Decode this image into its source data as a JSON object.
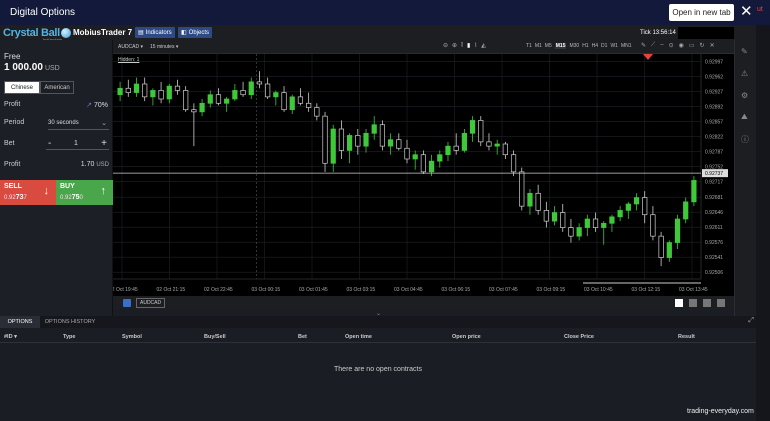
{
  "window": {
    "title": "Digital Options",
    "open_new_tab_label": "Open in new tab",
    "close_glyph": "✕",
    "corner_text": "ut"
  },
  "brand": {
    "logo_text": "Crystal Ball",
    "logo_subtext": "byKeydata",
    "platform": "MobiusTrader 7"
  },
  "toolbar": {
    "indicators_label": "Indicators",
    "objects_label": "Objects",
    "tick_label": "Tick 13:56:14"
  },
  "account": {
    "free_label": "Free",
    "balance": "1 000.00",
    "currency": "USD"
  },
  "option_type": {
    "options": [
      "Chinese",
      "American"
    ],
    "selected": "Chinese"
  },
  "form": {
    "profit_label": "Profit",
    "profit_pct": "70%",
    "period_label": "Period",
    "period_value": "30 seconds",
    "bet_label": "Bet",
    "bet_value": "1",
    "minus": "-",
    "plus": "+",
    "profit2_label": "Profit",
    "profit2_value": "1.70",
    "profit2_currency": "USD"
  },
  "trade": {
    "sell_label": "SELL",
    "sell_price_prefix": "0.92",
    "sell_price_bold": "73",
    "sell_price_suffix": "7",
    "buy_label": "BUY",
    "buy_price_prefix": "0.92",
    "buy_price_bold": "75",
    "buy_price_suffix": "0"
  },
  "chart_header": {
    "symbol": "AUDCAD",
    "timeframe": "15 minutes",
    "hidden_label": "Hidden: 1",
    "timeframes": [
      "T1",
      "M1",
      "M5",
      "M15",
      "M30",
      "H1",
      "H4",
      "D1",
      "W1",
      "MN1"
    ],
    "active_timeframe": "M15"
  },
  "chart_bottom": {
    "symbol_tab": "AUDCAD"
  },
  "chart_data": {
    "type": "candlestick",
    "symbol": "AUDCAD",
    "y_ticks": [
      "0.92997",
      "0.92962",
      "0.92927",
      "0.92892",
      "0.92857",
      "0.92822",
      "0.92787",
      "0.92752",
      "0.92717",
      "0.92681",
      "0.92646",
      "0.92611",
      "0.92576",
      "0.92541",
      "0.92506"
    ],
    "ylim": [
      0.9249,
      0.93015
    ],
    "current_price": "0.92737",
    "x_ticks": [
      "02 Oct 19:45",
      "02 Oct 21:15",
      "02 Oct 22:45",
      "03 Oct 00:15",
      "03 Oct 01:45",
      "03 Oct 03:15",
      "03 Oct 04:45",
      "03 Oct 06:15",
      "03 Oct 07:45",
      "03 Oct 09:15",
      "03 Oct 10:45",
      "03 Oct 12:15",
      "03 Oct 13:45"
    ],
    "candles": [
      [
        0.9292,
        0.9295,
        0.92905,
        0.92935
      ],
      [
        0.92935,
        0.92955,
        0.92915,
        0.92925
      ],
      [
        0.92925,
        0.9296,
        0.92915,
        0.92945
      ],
      [
        0.92945,
        0.9296,
        0.92905,
        0.92915
      ],
      [
        0.92915,
        0.92935,
        0.92895,
        0.9293
      ],
      [
        0.9293,
        0.9295,
        0.929,
        0.9291
      ],
      [
        0.9291,
        0.92945,
        0.929,
        0.9294
      ],
      [
        0.9294,
        0.92955,
        0.9292,
        0.9293
      ],
      [
        0.9293,
        0.9294,
        0.9288,
        0.92885
      ],
      [
        0.92885,
        0.929,
        0.928,
        0.9288
      ],
      [
        0.9288,
        0.9291,
        0.9287,
        0.929
      ],
      [
        0.929,
        0.9293,
        0.9289,
        0.9292
      ],
      [
        0.9292,
        0.92935,
        0.92895,
        0.929
      ],
      [
        0.929,
        0.92915,
        0.9288,
        0.9291
      ],
      [
        0.9291,
        0.92945,
        0.92905,
        0.9293
      ],
      [
        0.9293,
        0.9295,
        0.92915,
        0.9292
      ],
      [
        0.9292,
        0.9296,
        0.9291,
        0.9295
      ],
      [
        0.9295,
        0.92975,
        0.92935,
        0.92945
      ],
      [
        0.92945,
        0.9296,
        0.9291,
        0.92915
      ],
      [
        0.92915,
        0.9293,
        0.92895,
        0.92925
      ],
      [
        0.92925,
        0.9294,
        0.9288,
        0.92885
      ],
      [
        0.92885,
        0.9292,
        0.92875,
        0.92915
      ],
      [
        0.92915,
        0.92935,
        0.92895,
        0.929
      ],
      [
        0.929,
        0.92925,
        0.9288,
        0.9289
      ],
      [
        0.9289,
        0.929,
        0.9286,
        0.9287
      ],
      [
        0.9287,
        0.9288,
        0.9274,
        0.9276
      ],
      [
        0.9276,
        0.9285,
        0.9274,
        0.9284
      ],
      [
        0.9284,
        0.9286,
        0.9277,
        0.9279
      ],
      [
        0.9279,
        0.9283,
        0.9276,
        0.92825
      ],
      [
        0.92825,
        0.9284,
        0.9278,
        0.928
      ],
      [
        0.928,
        0.9284,
        0.92785,
        0.9283
      ],
      [
        0.9283,
        0.9287,
        0.92815,
        0.9285
      ],
      [
        0.9285,
        0.9286,
        0.9279,
        0.928
      ],
      [
        0.928,
        0.9283,
        0.9278,
        0.92815
      ],
      [
        0.92815,
        0.9283,
        0.9279,
        0.92795
      ],
      [
        0.92795,
        0.92815,
        0.9276,
        0.9277
      ],
      [
        0.9277,
        0.9279,
        0.92745,
        0.9278
      ],
      [
        0.9278,
        0.9279,
        0.92735,
        0.9274
      ],
      [
        0.9274,
        0.9278,
        0.9273,
        0.92765
      ],
      [
        0.92765,
        0.9279,
        0.9275,
        0.9278
      ],
      [
        0.9278,
        0.9281,
        0.92765,
        0.928
      ],
      [
        0.928,
        0.9283,
        0.9278,
        0.9279
      ],
      [
        0.9279,
        0.9284,
        0.92785,
        0.9283
      ],
      [
        0.9283,
        0.9287,
        0.9281,
        0.9286
      ],
      [
        0.9286,
        0.9287,
        0.928,
        0.9281
      ],
      [
        0.9281,
        0.9283,
        0.9279,
        0.928
      ],
      [
        0.928,
        0.92815,
        0.9278,
        0.92805
      ],
      [
        0.92805,
        0.9281,
        0.9277,
        0.9278
      ],
      [
        0.9278,
        0.9279,
        0.9273,
        0.9274
      ],
      [
        0.9274,
        0.9275,
        0.9265,
        0.9266
      ],
      [
        0.9266,
        0.927,
        0.9264,
        0.9269
      ],
      [
        0.9269,
        0.9271,
        0.9264,
        0.9265
      ],
      [
        0.9265,
        0.9267,
        0.9261,
        0.92625
      ],
      [
        0.92625,
        0.9266,
        0.92615,
        0.92645
      ],
      [
        0.92645,
        0.92665,
        0.926,
        0.9261
      ],
      [
        0.9261,
        0.9263,
        0.92575,
        0.9259
      ],
      [
        0.9259,
        0.9262,
        0.9258,
        0.9261
      ],
      [
        0.9261,
        0.9264,
        0.9259,
        0.9263
      ],
      [
        0.9263,
        0.92645,
        0.926,
        0.9261
      ],
      [
        0.9261,
        0.92625,
        0.9257,
        0.9262
      ],
      [
        0.9262,
        0.9264,
        0.926,
        0.92635
      ],
      [
        0.92635,
        0.9266,
        0.92625,
        0.9265
      ],
      [
        0.9265,
        0.9267,
        0.9263,
        0.92665
      ],
      [
        0.92665,
        0.9269,
        0.9265,
        0.9268
      ],
      [
        0.9268,
        0.92695,
        0.9262,
        0.9264
      ],
      [
        0.9264,
        0.9266,
        0.9258,
        0.9259
      ],
      [
        0.9259,
        0.926,
        0.9252,
        0.9254
      ],
      [
        0.9254,
        0.9258,
        0.9253,
        0.92575
      ],
      [
        0.92575,
        0.9264,
        0.9256,
        0.9263
      ],
      [
        0.9263,
        0.9268,
        0.9262,
        0.9267
      ],
      [
        0.9267,
        0.9273,
        0.9266,
        0.9272
      ]
    ]
  },
  "options_panel": {
    "tabs": [
      "OPTIONS",
      "OPTIONS HISTORY"
    ],
    "columns": [
      "#ID",
      "Type",
      "Symbol",
      "Buy/Sell",
      "Bet",
      "Open time",
      "Open price",
      "Close Price",
      "Result"
    ],
    "empty_message": "There are no open contracts"
  },
  "watermark": "trading-everyday.com",
  "colors": {
    "bull": "#3ec83a",
    "bear": "#cfcfcf",
    "sell": "#d94a3f",
    "buy": "#4aa64a",
    "header": "#12193a",
    "marker": "#e8423f"
  }
}
